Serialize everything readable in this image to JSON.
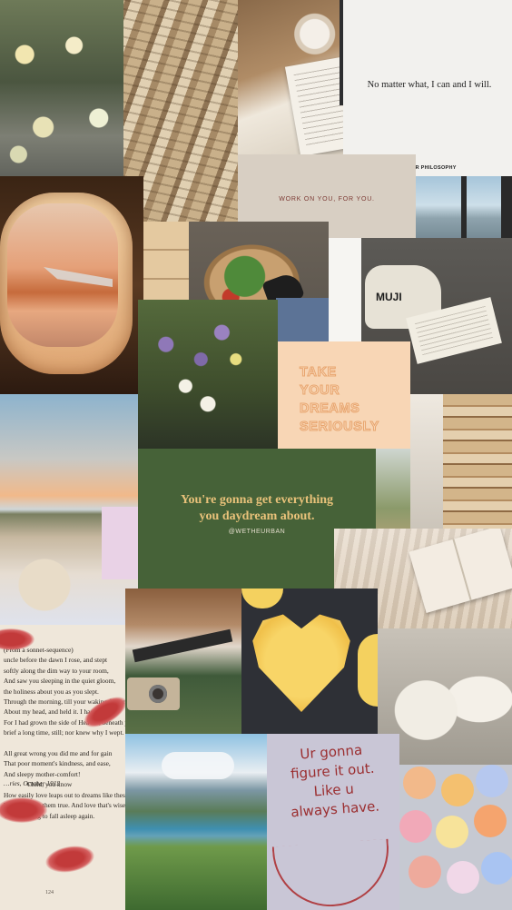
{
  "quotes": {
    "inner_philosophy_quote": "No matter what, I can and I will.",
    "inner_philosophy_source": "INNER PHILOSOPHY",
    "work_on_you": "WORK ON YOU, FOR YOU.",
    "take_dreams": [
      "TAKE",
      "YOUR",
      "DREAMS",
      "SERIOUSLY"
    ],
    "daydream_line1": "You're gonna get everything",
    "daydream_line2": "you daydream about.",
    "daydream_handle": "@WETHEURBAN",
    "figure_it_out": [
      "Ur gonna",
      "figure it out.",
      "Like u",
      "always have."
    ]
  },
  "bag_label": "MUJI",
  "poem": {
    "text": "(From a sonnet-sequence)\nuncle before the dawn I rose, and stept\nsoftly along the dim way to your room,\nAnd saw you sleeping in the quiet gloom,\nthe holiness about you as you slept.\nThrough the morning, till your waking fingers crept\nAbout my head, and held it. I had rest\nFor I had grown the side of Heaven, beneath your breast,\nbrief a long time, still; nor knew why I wept.\n\nAll great wrong you did me and for gain\nThat poor moment's kindness, and ease,\nAnd sleepy mother-comfort!\n              Child, you know\nHow easily love leaps out to dreams like these,\nWho has seen them true. And love that's wise\nWill, too long to fall asleep again.",
    "date": "…ries, October 1913",
    "page": "124"
  },
  "colors": {
    "green_panel": "#466238",
    "gold_text": "#e9c27a",
    "peach_panel": "#f8d6b5",
    "peach_stroke": "#e8a56f",
    "maroon_text": "#7c3a34",
    "note_red": "#9b2e30"
  }
}
